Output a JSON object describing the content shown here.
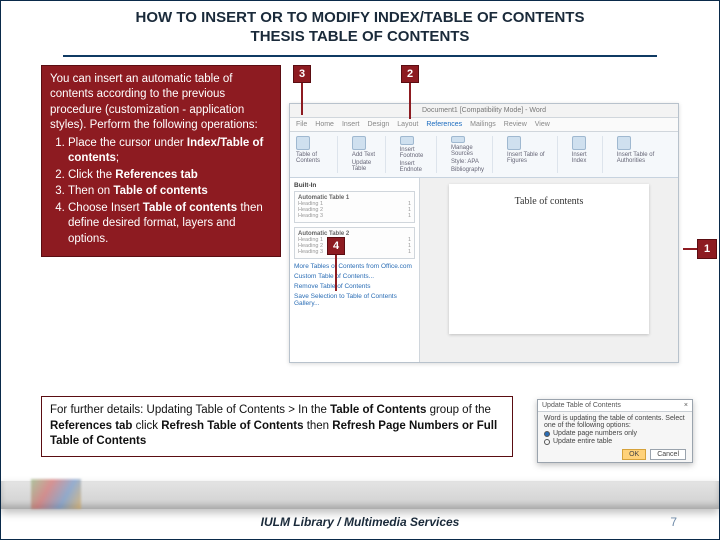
{
  "title": {
    "line1": "HOW TO INSERT OR TO MODIFY INDEX/TABLE OF CONTENTS",
    "line2": "THESIS TABLE OF CONTENTS"
  },
  "instructions": {
    "intro_1": "You can insert an automatic table of contents according to the previous procedure (customization - application styles). Perform the following operations:",
    "steps": [
      {
        "prefix": "Place the cursor under ",
        "bold": "Index/Table of contents",
        "suffix": ";"
      },
      {
        "prefix": "Click the ",
        "bold": "References tab",
        "suffix": ""
      },
      {
        "prefix": "Then on ",
        "bold": "Table of contents",
        "suffix": ""
      },
      {
        "prefix": "Choose Insert ",
        "bold": "Table of contents",
        "suffix": " then define desired format, layers and options."
      }
    ]
  },
  "callouts": {
    "c1": "1",
    "c2": "2",
    "c3": "3",
    "c4": "4"
  },
  "word": {
    "titlebar": "Document1 [Compatibility Mode] - Word",
    "tabs": [
      "File",
      "Home",
      "Insert",
      "Design",
      "Layout",
      "References",
      "Mailings",
      "Review",
      "View"
    ],
    "active_tab": "References",
    "ribbon": [
      {
        "label": "Table of Contents"
      },
      {
        "label": "Add Text"
      },
      {
        "label": "Update Table"
      },
      {
        "label": "Insert Footnote"
      },
      {
        "label": "Insert Endnote"
      },
      {
        "label": "Manage Sources"
      },
      {
        "label": "Style: APA"
      },
      {
        "label": "Bibliography"
      },
      {
        "label": "Insert Table of Figures"
      },
      {
        "label": "Insert Index"
      },
      {
        "label": "Insert Table of Authorities"
      }
    ],
    "toc": {
      "header": "Built-In",
      "opt1": {
        "title": "Automatic Table 1",
        "r1l": "Heading 1",
        "r1r": "1",
        "r2l": "Heading 2",
        "r2r": "1",
        "r3l": "Heading 3",
        "r3r": "1"
      },
      "opt2": {
        "title": "Automatic Table 2",
        "r1l": "Heading 1",
        "r1r": "1",
        "r2l": "Heading 2",
        "r2r": "1",
        "r3l": "Heading 3",
        "r3r": "1"
      },
      "links": [
        "More Tables of Contents from Office.com",
        "Custom Table of Contents...",
        "Remove Table of Contents",
        "Save Selection to Table of Contents Gallery..."
      ]
    },
    "page_title": "Table of contents"
  },
  "further": {
    "prefix": "For further details: Updating Table of Contents > In the ",
    "bold1": "Table of Contents",
    "mid1": " group of the ",
    "bold2": "References tab",
    "mid2": " click ",
    "bold3": "Refresh Table of Contents",
    "mid3": " then ",
    "bold4": "Refresh Page Numbers or Full Table of Contents"
  },
  "dialog": {
    "title": "Update Table of Contents",
    "close": "×",
    "msg": "Word is updating the table of contents. Select one of the following options:",
    "opt1": "Update page numbers only",
    "opt2": "Update entire table",
    "ok": "OK",
    "cancel": "Cancel"
  },
  "footer": "IULM Library / Multimedia Services",
  "page_number": "7"
}
